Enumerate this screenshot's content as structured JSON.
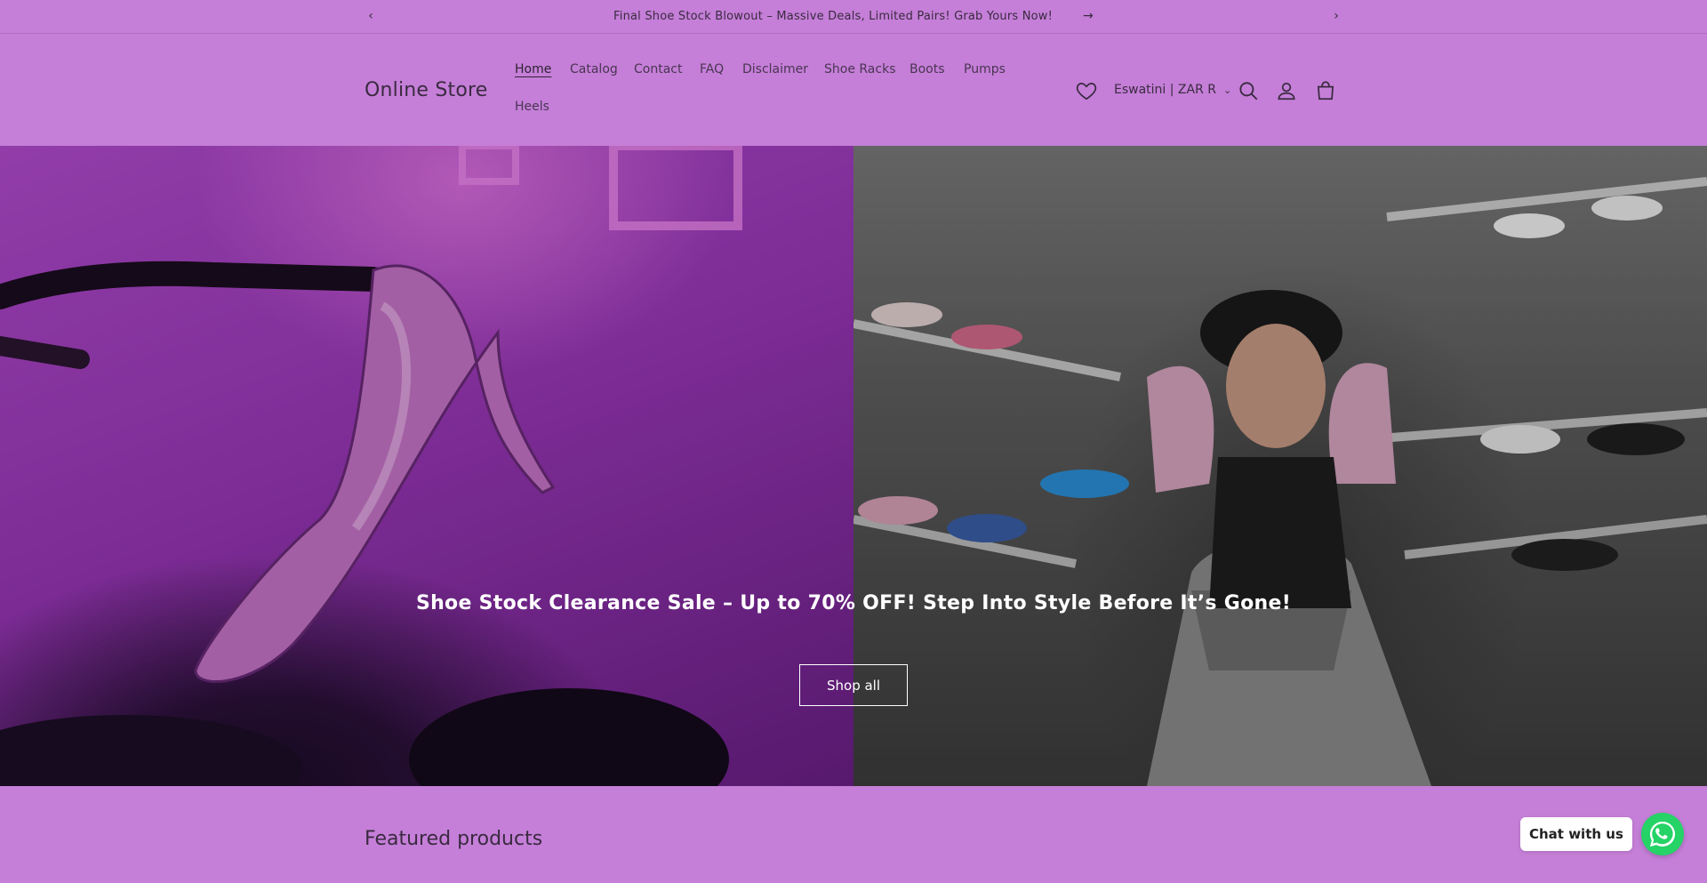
{
  "announcement": {
    "message": "Final Shoe Stock Blowout – Massive Deals, Limited Pairs! Grab Yours Now!",
    "prev_icon": "chevron-left-icon",
    "next_icon": "chevron-right-icon",
    "link_icon": "arrow-right-icon"
  },
  "header": {
    "logo": "Online Store",
    "nav": [
      {
        "label": "Home",
        "active": true
      },
      {
        "label": "Catalog"
      },
      {
        "label": "Contact"
      },
      {
        "label": "FAQ"
      },
      {
        "label": "Disclaimer"
      },
      {
        "label": "Shoe Racks"
      },
      {
        "label": "Boots"
      },
      {
        "label": "Pumps"
      },
      {
        "label": "Heels"
      }
    ],
    "locale": "Eswatini | ZAR R",
    "icons": [
      "heart-icon",
      "search-icon",
      "account-icon",
      "cart-icon"
    ]
  },
  "hero": {
    "title": "Shoe Stock Clearance Sale – Up to 70% OFF! Step Into Style Before It’s Gone!",
    "button_label": "Shop all"
  },
  "featured": {
    "heading": "Featured products"
  },
  "chat": {
    "label": "Chat with us",
    "icon": "whatsapp-icon"
  },
  "colors": {
    "background": "#c57fd8",
    "chat_green": "#25d366"
  }
}
